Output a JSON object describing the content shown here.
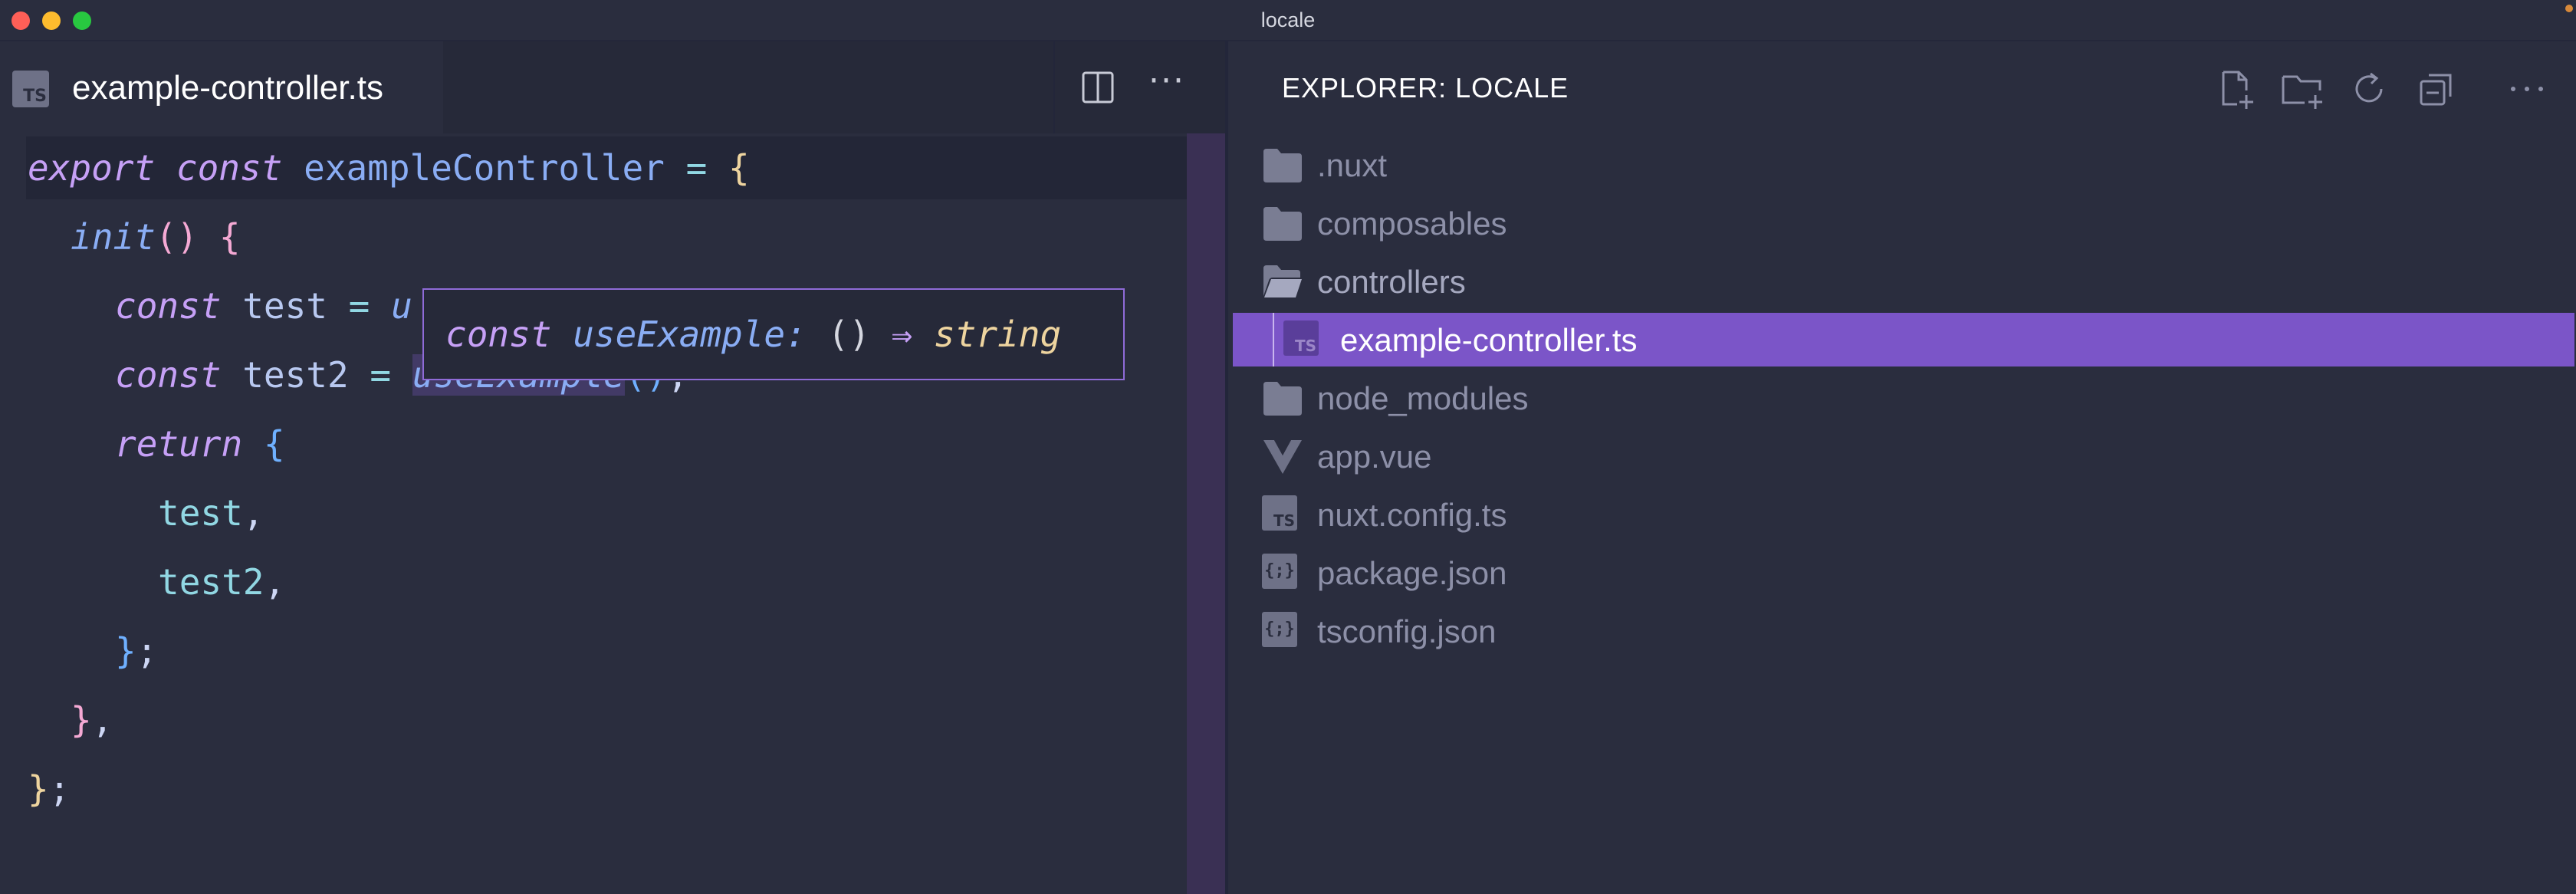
{
  "window": {
    "title": "locale"
  },
  "editor": {
    "tab": {
      "label": "example-controller.ts",
      "icon": "typescript-file-icon",
      "badge": "TS"
    },
    "actions": {
      "split": "split-editor-icon",
      "more": "···"
    },
    "code": {
      "l1": {
        "kw1": "export",
        "kw2": "const",
        "name": "exampleController",
        "eq": "=",
        "brace": "{"
      },
      "l2": {
        "fn": "init",
        "parens": "()",
        "brace": "{"
      },
      "l3": {
        "kw": "const",
        "name": "test",
        "eq": "=",
        "partial": "u"
      },
      "l4": {
        "kw": "const",
        "name": "test2",
        "eq": "=",
        "call": "useExample",
        "parens": "()",
        "semi": ";"
      },
      "l5": {
        "kw": "return",
        "brace": "{"
      },
      "l6": {
        "prop": "test",
        "comma": ","
      },
      "l7": {
        "prop": "test2",
        "comma": ","
      },
      "l8": {
        "brace": "}",
        "semi": ";"
      },
      "l9": {
        "brace": "}",
        "comma": ","
      },
      "l10": {
        "brace": "}",
        "semi": ";"
      }
    },
    "hover": {
      "kw": "const",
      "name": "useExample:",
      "sig": "()",
      "arrow": "⇒",
      "type": "string"
    }
  },
  "explorer": {
    "title": "EXPLORER: LOCALE",
    "actions": [
      "new-file-icon",
      "new-folder-icon",
      "refresh-icon",
      "collapse-all-icon",
      "more-icon"
    ],
    "items": [
      {
        "label": ".nuxt",
        "type": "folder"
      },
      {
        "label": "composables",
        "type": "folder"
      },
      {
        "label": "controllers",
        "type": "folder-open"
      },
      {
        "label": "example-controller.ts",
        "type": "ts",
        "selected": true
      },
      {
        "label": "node_modules",
        "type": "folder"
      },
      {
        "label": "app.vue",
        "type": "vue"
      },
      {
        "label": "nuxt.config.ts",
        "type": "ts"
      },
      {
        "label": "package.json",
        "type": "json"
      },
      {
        "label": "tsconfig.json",
        "type": "json"
      }
    ],
    "ts_badge": "TS",
    "json_badge": "{;}"
  }
}
